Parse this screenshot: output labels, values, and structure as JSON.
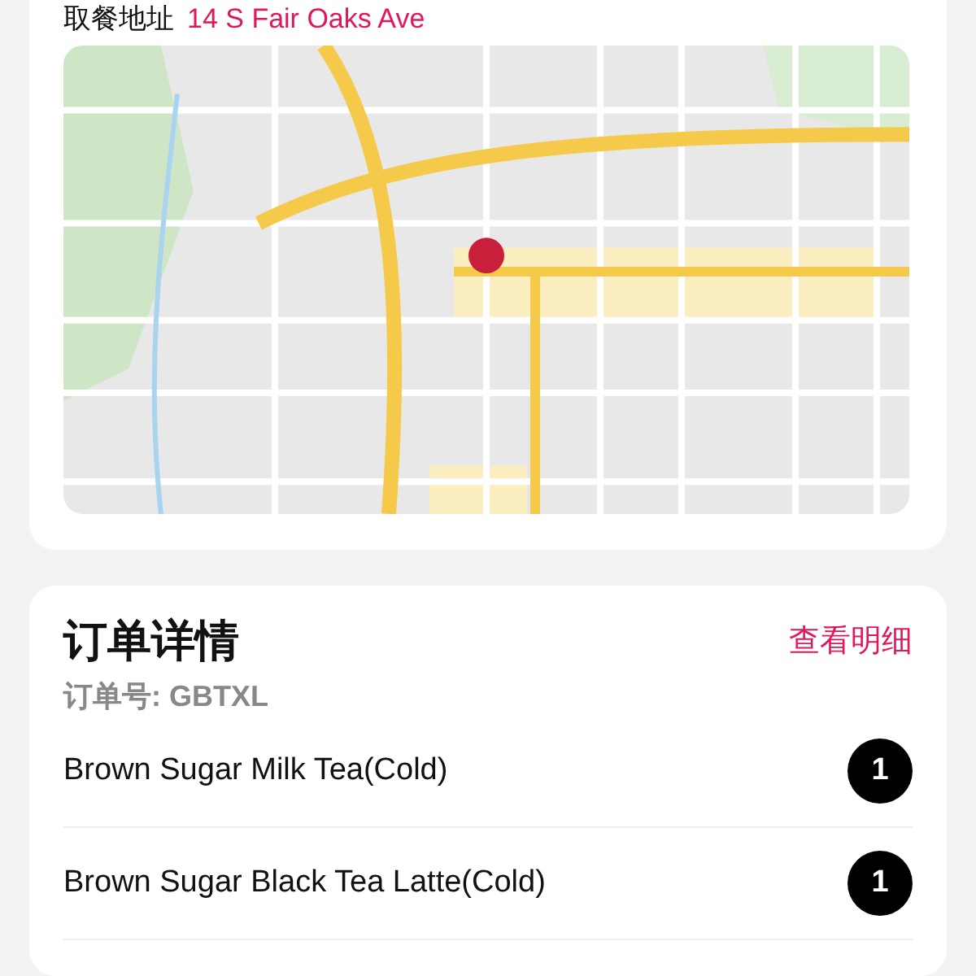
{
  "pickup": {
    "label": "取餐地址",
    "address": "14 S Fair Oaks Ave"
  },
  "order": {
    "title": "订单详情",
    "link": "查看明细",
    "number_label": "订单号:",
    "number": "GBTXL",
    "items": [
      {
        "name": "Brown Sugar Milk Tea(Cold)",
        "qty": "1"
      },
      {
        "name": "Brown Sugar Black Tea Latte(Cold)",
        "qty": "1"
      }
    ]
  }
}
